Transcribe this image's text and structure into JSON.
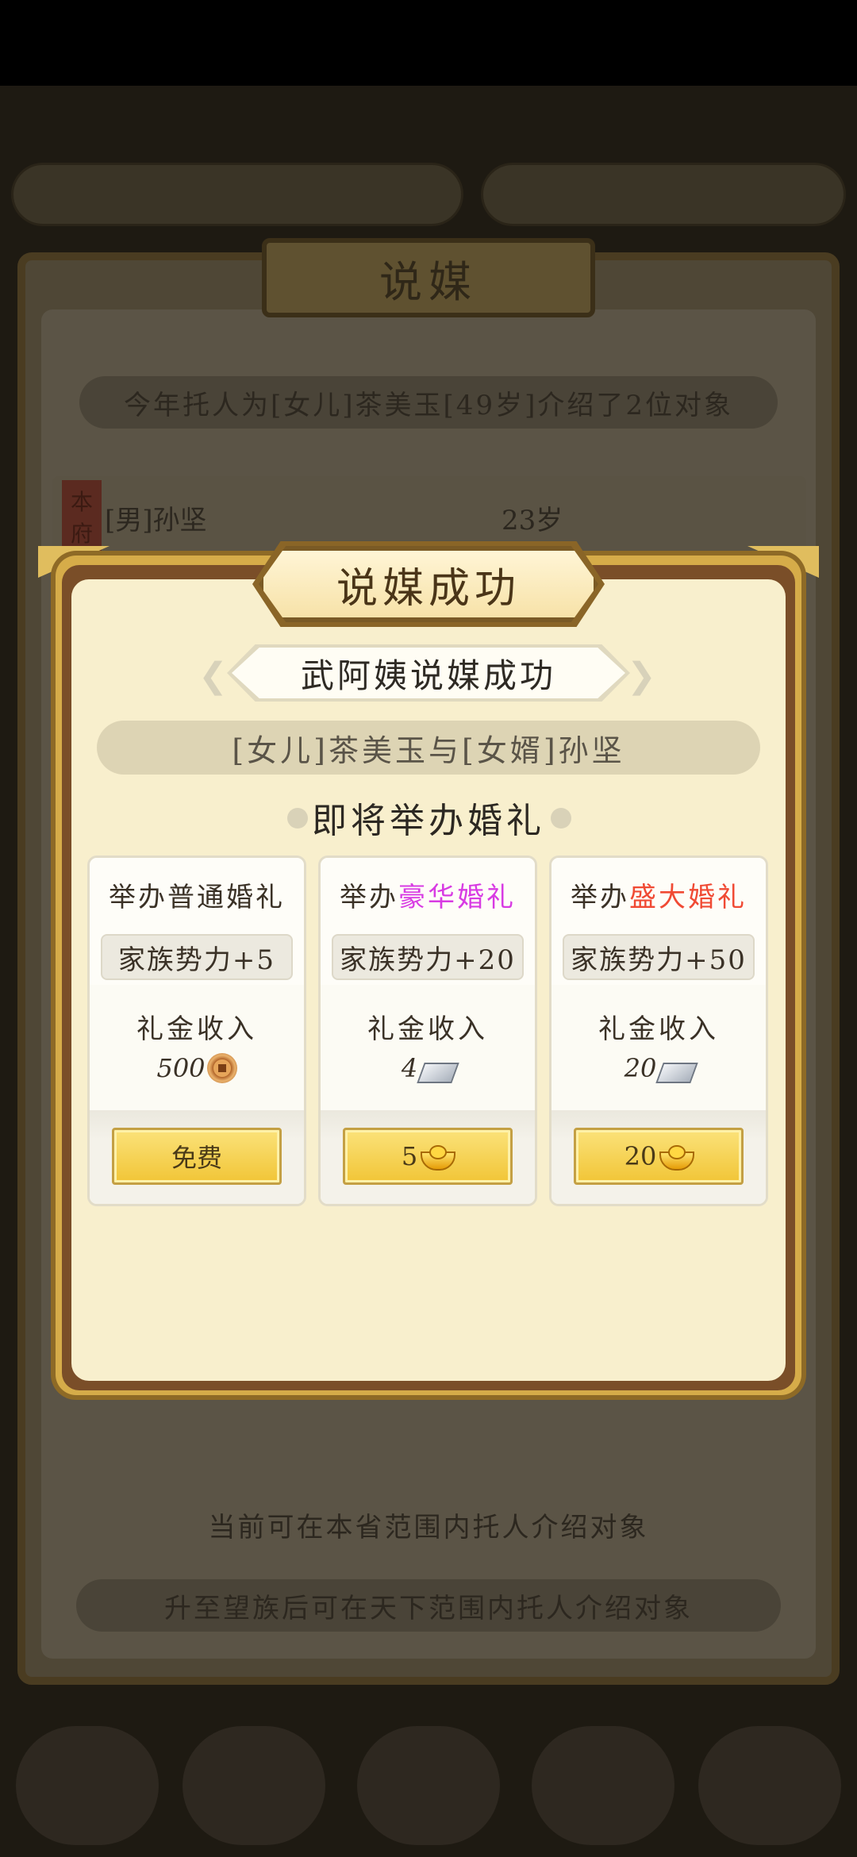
{
  "background": {
    "panel_title": "说媒",
    "intro_line": "今年托人为[女儿]茶美玉[49岁]介绍了2位对象",
    "candidate": {
      "tag": "本府",
      "name": "[男]孙坚",
      "age": "23岁"
    },
    "range_line": "当前可在本省范围内托人介绍对象",
    "upgrade_line": "升至望族后可在天下范围内托人介绍对象"
  },
  "modal": {
    "title": "说媒成功",
    "subtitle": "武阿姨说媒成功",
    "couple": "[女儿]茶美玉与[女婿]孙坚",
    "section_title": "即将举办婚礼",
    "income_label": "礼金收入",
    "options": [
      {
        "title_prefix": "举办",
        "title_highlight": "普通婚礼",
        "highlight_color": "#3a3126",
        "power": "家族势力+5",
        "income_amount": "500",
        "income_icon": "copper-coin-icon",
        "button_label": "免费"
      },
      {
        "title_prefix": "举办",
        "title_highlight": "豪华婚礼",
        "highlight_color": "#d83be3",
        "power": "家族势力+20",
        "income_amount": "4",
        "income_icon": "silver-ingot-icon",
        "button_label": "5",
        "button_icon": "gold-ingot-icon"
      },
      {
        "title_prefix": "举办",
        "title_highlight": "盛大婚礼",
        "highlight_color": "#f04a34",
        "power": "家族势力+50",
        "income_amount": "20",
        "income_icon": "silver-ingot-icon",
        "button_label": "20",
        "button_icon": "gold-ingot-icon"
      }
    ]
  }
}
